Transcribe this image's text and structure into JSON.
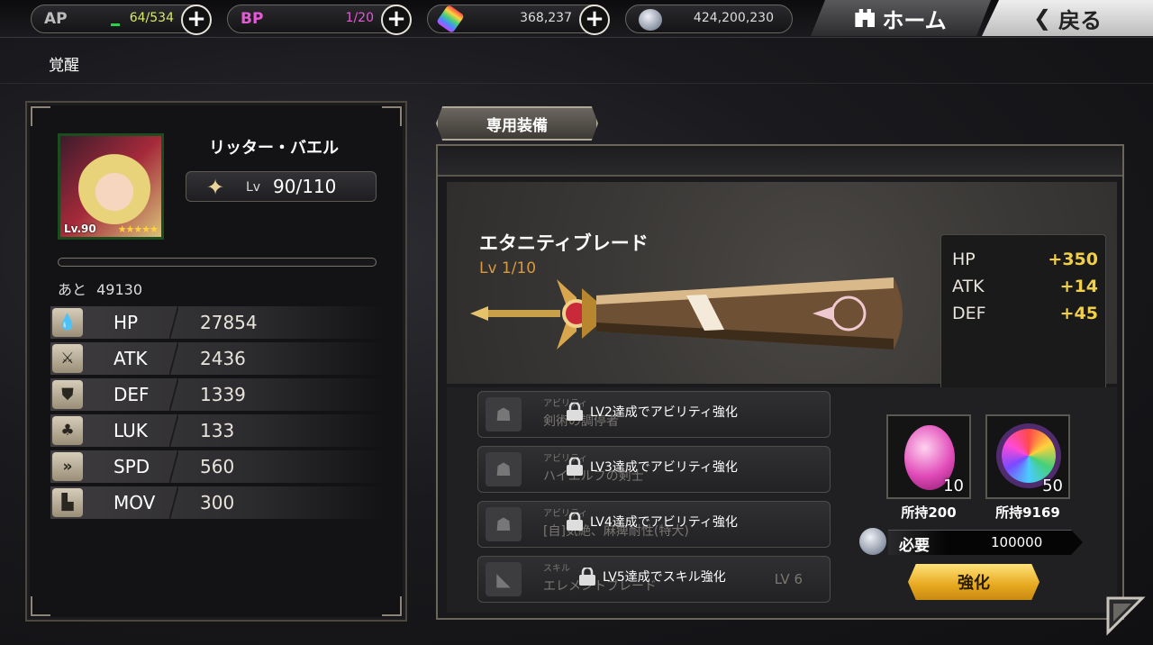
{
  "header": {
    "ap": {
      "label": "AP",
      "value": "64/534"
    },
    "bp": {
      "label": "BP",
      "value": "1/20"
    },
    "crystal": {
      "value": "368,237"
    },
    "coins": {
      "value": "424,200,230"
    },
    "plus_label": "+",
    "home_label": "ホーム",
    "back_label": "戻る"
  },
  "page_title": "覚醒",
  "character": {
    "name": "リッター・バエル",
    "portrait_level": "Lv.90",
    "stars": "★★★★★",
    "lv_label": "Lv",
    "lv_value": "90/110",
    "remaining_label": "あと",
    "remaining_value": "49130",
    "stats": [
      {
        "icon": "water-drop-icon",
        "name": "HP",
        "value": "27854"
      },
      {
        "icon": "sword-icon",
        "name": "ATK",
        "value": "2436"
      },
      {
        "icon": "shield-icon",
        "name": "DEF",
        "value": "1339"
      },
      {
        "icon": "clover-icon",
        "name": "LUK",
        "value": "133"
      },
      {
        "icon": "double-chevron-icon",
        "name": "SPD",
        "value": "560"
      },
      {
        "icon": "boot-icon",
        "name": "MOV",
        "value": "300"
      }
    ]
  },
  "tab_label": "専用装備",
  "weapon": {
    "name": "エタニティブレード",
    "level": "Lv 1/10",
    "bonus": [
      {
        "name": "HP",
        "value": "+350"
      },
      {
        "name": "ATK",
        "value": "+14"
      },
      {
        "name": "DEF",
        "value": "+45"
      }
    ]
  },
  "abilities": [
    {
      "category": "アビリティ",
      "name": "剣術の調停者",
      "lock_text": "LV2達成でアビリティ強化",
      "level": ""
    },
    {
      "category": "アビリティ",
      "name": "ハイエルフの剣士",
      "lock_text": "LV3達成でアビリティ強化",
      "level": ""
    },
    {
      "category": "アビリティ",
      "name": "[自]気絶、麻痺耐性(特大)",
      "lock_text": "LV4達成でアビリティ強化",
      "level": ""
    },
    {
      "category": "スキル",
      "name": "エレメントブレード",
      "lock_text": "LV5達成でスキル強化",
      "level": "LV 6"
    }
  ],
  "materials": [
    {
      "count": "10",
      "owned": "所持200"
    },
    {
      "count": "50",
      "owned": "所持9169"
    }
  ],
  "required": {
    "label": "必要",
    "value": "100000"
  },
  "enhance_label": "強化"
}
